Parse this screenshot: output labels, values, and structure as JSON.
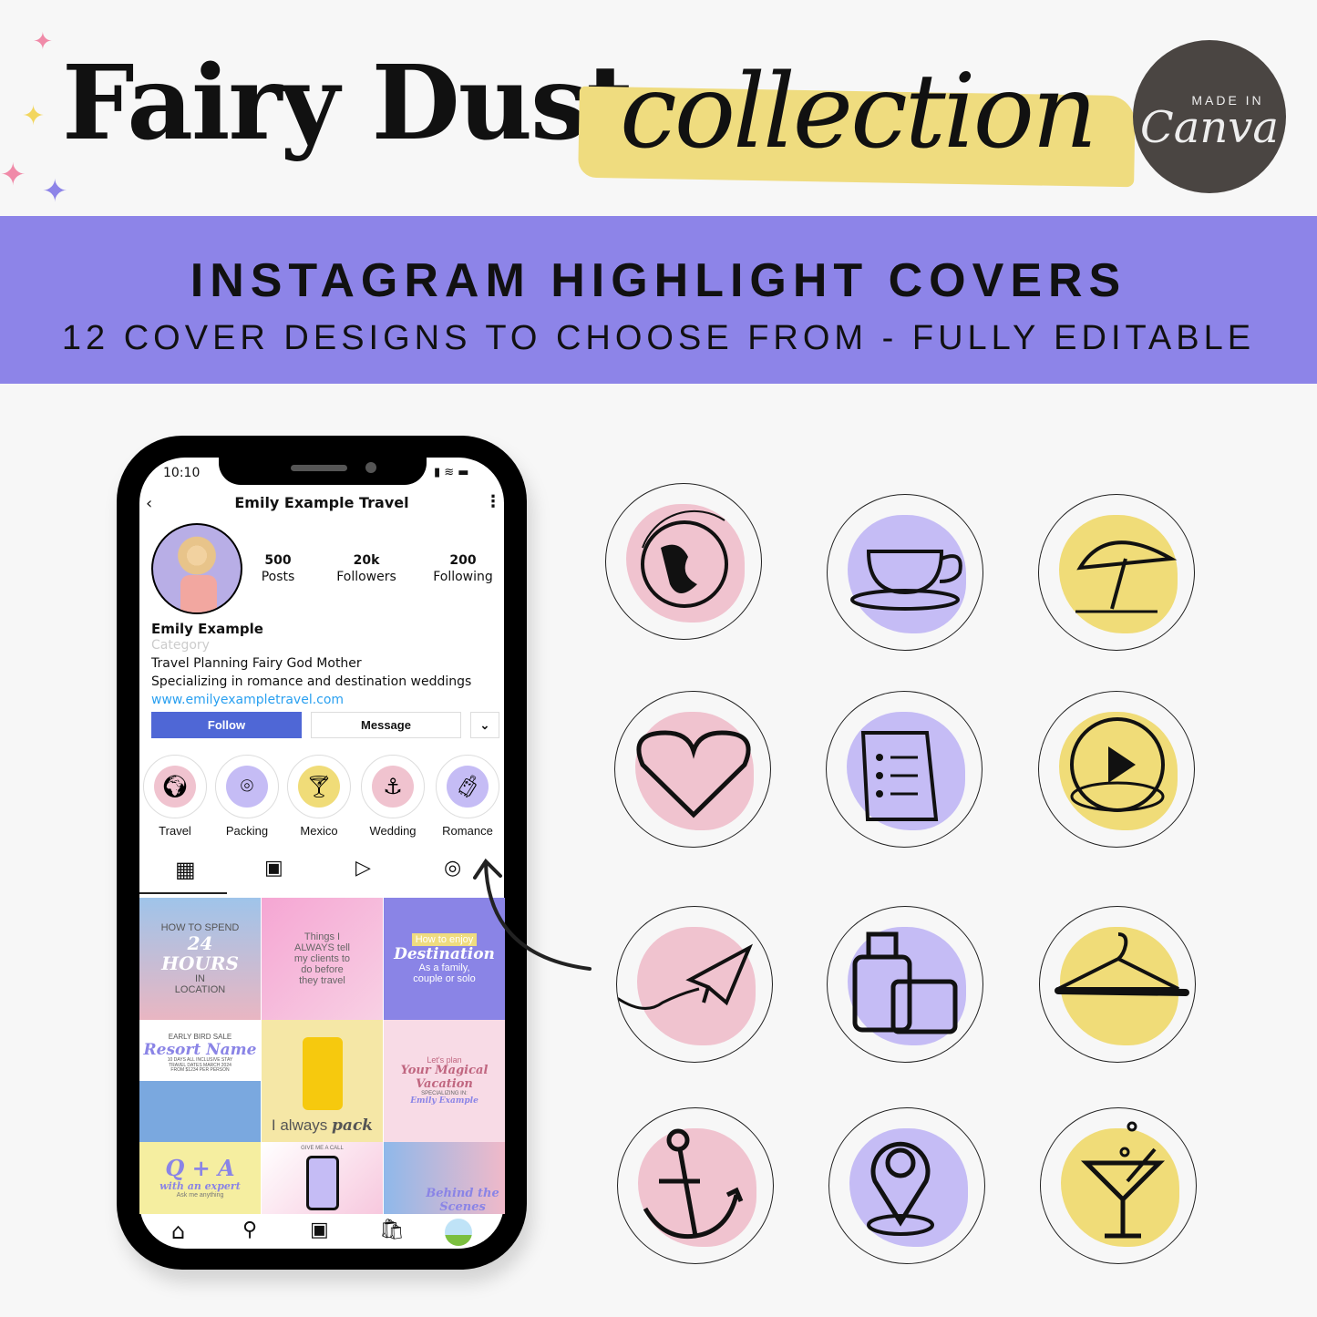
{
  "header": {
    "title_main": "Fairy Dust",
    "title_script": "collection",
    "badge_top": "MADE IN",
    "badge_brand": "Canva"
  },
  "banner": {
    "heading": "INSTAGRAM HIGHLIGHT COVERS",
    "subheading": "12 COVER DESIGNS TO CHOOSE FROM - FULLY EDITABLE"
  },
  "colors": {
    "pink": "#f0c3cf",
    "purple": "#c5bcf5",
    "yellow": "#f0dc78",
    "band": "#8d84e8",
    "follow": "#4f67d6"
  },
  "phone": {
    "time": "10:10",
    "account": "Emily Example Travel",
    "stats": [
      {
        "value": "500",
        "label": "Posts"
      },
      {
        "value": "20k",
        "label": "Followers"
      },
      {
        "value": "200",
        "label": "Following"
      }
    ],
    "name": "Emily Example",
    "category": "Category",
    "bio": [
      "Travel Planning Fairy God Mother",
      "Specializing in romance and destination weddings"
    ],
    "link": "www.emilyexampletravel.com",
    "follow": "Follow",
    "message": "Message",
    "highlights": [
      {
        "label": "Travel",
        "icon": "globe"
      },
      {
        "label": "Packing",
        "icon": "map-pin"
      },
      {
        "label": "Mexico",
        "icon": "cocktail"
      },
      {
        "label": "Wedding",
        "icon": "anchor"
      },
      {
        "label": "Romance",
        "icon": "luggage"
      }
    ],
    "posts": [
      {
        "lines": [
          "HOW TO SPEND",
          "24",
          "HOURS",
          "IN",
          "LOCATION"
        ]
      },
      {
        "lines": [
          "Things I",
          "ALWAYS tell",
          "my clients to",
          "do before",
          "they travel"
        ]
      },
      {
        "lines": [
          "How to enjoy",
          "Destination",
          "As a family,",
          "couple or solo"
        ]
      },
      {
        "lines": [
          "EARLY BIRD SALE",
          "Resort Name",
          "10 DAYS ALL INCLUSIVE STAY",
          "TRAVEL DATES MARCH 2024",
          "FROM $1234 PER PERSON"
        ]
      },
      {
        "lines": [
          "I always",
          "pack"
        ]
      },
      {
        "lines": [
          "Let's plan",
          "Your Magical Vacation",
          "SPECIALIZING IN:",
          "Emily Example"
        ]
      },
      {
        "lines": [
          "Q + A",
          "with an expert",
          "Ask me anything"
        ]
      },
      {
        "lines": [
          "GIVE ME A CALL"
        ]
      },
      {
        "lines": [
          "Behind the Scenes"
        ]
      }
    ]
  },
  "covers": [
    "globe",
    "teacup",
    "beach-umbrella",
    "heart",
    "checklist",
    "play-button",
    "paper-plane",
    "luggage",
    "hanger",
    "anchor",
    "map-pin",
    "cocktail"
  ]
}
